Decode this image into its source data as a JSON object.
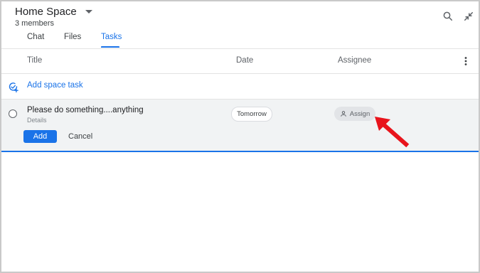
{
  "header": {
    "space_name": "Home Space",
    "members_label": "3 members",
    "icons": [
      "search-icon",
      "collapse-icon",
      "chevron-down-icon"
    ]
  },
  "tabs": [
    {
      "label": "Chat",
      "active": false
    },
    {
      "label": "Files",
      "active": false
    },
    {
      "label": "Tasks",
      "active": true
    }
  ],
  "columns": {
    "title": "Title",
    "date": "Date",
    "assignee": "Assignee"
  },
  "add_task": {
    "label": "Add space task",
    "icon": "add-task-icon"
  },
  "task_editor": {
    "title_value": "Please do something....anything",
    "details_placeholder": "Details",
    "date_chip": "Tomorrow",
    "assign_chip": "Assign",
    "add_button": "Add",
    "cancel_button": "Cancel"
  },
  "colors": {
    "accent": "#1a73e8",
    "annotation_arrow": "#e8141c",
    "row_highlight": "#f1f3f4"
  }
}
